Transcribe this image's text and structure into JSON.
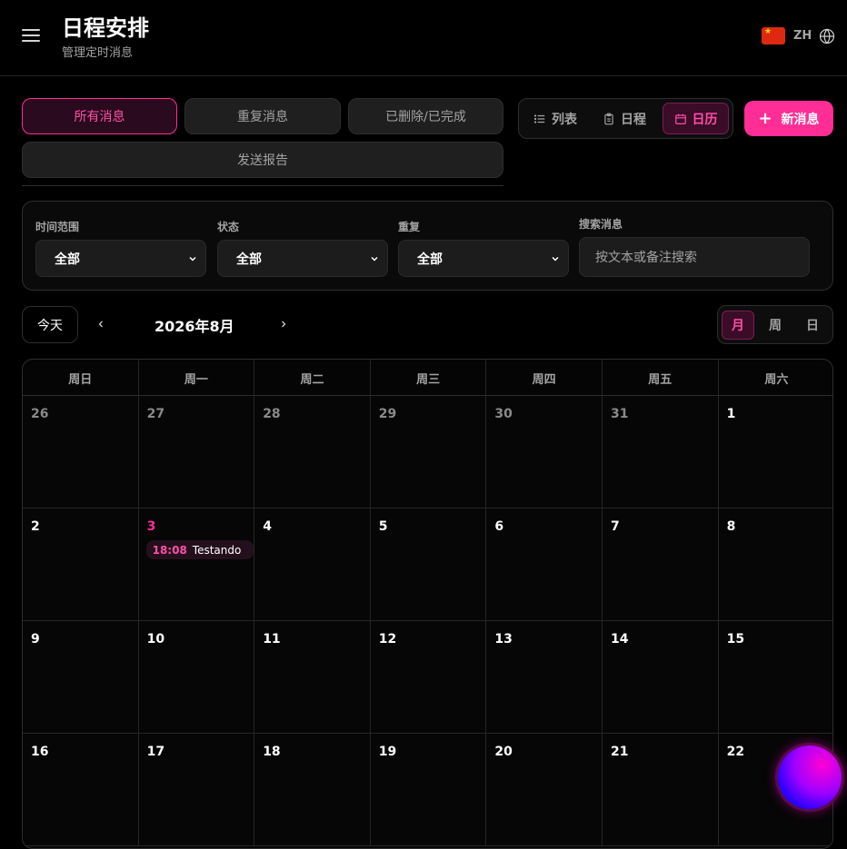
{
  "header": {
    "title": "日程安排",
    "subtitle": "管理定时消息",
    "language": "ZH",
    "flag_star": "★"
  },
  "tabs": [
    {
      "label": "所有消息",
      "active": true
    },
    {
      "label": "重复消息",
      "active": false
    },
    {
      "label": "已删除/已完成",
      "active": false
    },
    {
      "label": "发送报告",
      "active": false
    }
  ],
  "views": [
    {
      "label": "列表",
      "icon": "list-icon",
      "active": false
    },
    {
      "label": "日程",
      "icon": "clipboard-icon",
      "active": false
    },
    {
      "label": "日历",
      "icon": "calendar-icon",
      "active": true
    }
  ],
  "new_button": {
    "label": "新消息",
    "plus": "+"
  },
  "filters": {
    "time_range": {
      "label": "时间范围",
      "value": "全部"
    },
    "status": {
      "label": "状态",
      "value": "全部"
    },
    "repeat": {
      "label": "重复",
      "value": "全部"
    },
    "search": {
      "label": "搜索消息",
      "placeholder": "按文本或备注搜索"
    }
  },
  "calendar": {
    "today_label": "今天",
    "month_title": "2026年8月",
    "modes": [
      {
        "label": "月",
        "active": true
      },
      {
        "label": "周",
        "active": false
      },
      {
        "label": "日",
        "active": false
      }
    ],
    "weekdays": [
      "周日",
      "周一",
      "周二",
      "周三",
      "周四",
      "周五",
      "周六"
    ],
    "weeks": [
      [
        {
          "day": "26",
          "outside": true
        },
        {
          "day": "27",
          "outside": true
        },
        {
          "day": "28",
          "outside": true
        },
        {
          "day": "29",
          "outside": true
        },
        {
          "day": "30",
          "outside": true
        },
        {
          "day": "31",
          "outside": true
        },
        {
          "day": "1"
        }
      ],
      [
        {
          "day": "2"
        },
        {
          "day": "3",
          "today": true,
          "events": [
            {
              "time": "18:08",
              "title": "Testando"
            }
          ]
        },
        {
          "day": "4"
        },
        {
          "day": "5"
        },
        {
          "day": "6"
        },
        {
          "day": "7"
        },
        {
          "day": "8"
        }
      ],
      [
        {
          "day": "9"
        },
        {
          "day": "10"
        },
        {
          "day": "11"
        },
        {
          "day": "12"
        },
        {
          "day": "13"
        },
        {
          "day": "14"
        },
        {
          "day": "15"
        }
      ],
      [
        {
          "day": "16"
        },
        {
          "day": "17"
        },
        {
          "day": "18"
        },
        {
          "day": "19"
        },
        {
          "day": "20"
        },
        {
          "day": "21"
        },
        {
          "day": "22"
        }
      ]
    ]
  },
  "colors": {
    "accent": "#ff2d95",
    "background": "#000000",
    "panel": "#1f1f1f"
  }
}
